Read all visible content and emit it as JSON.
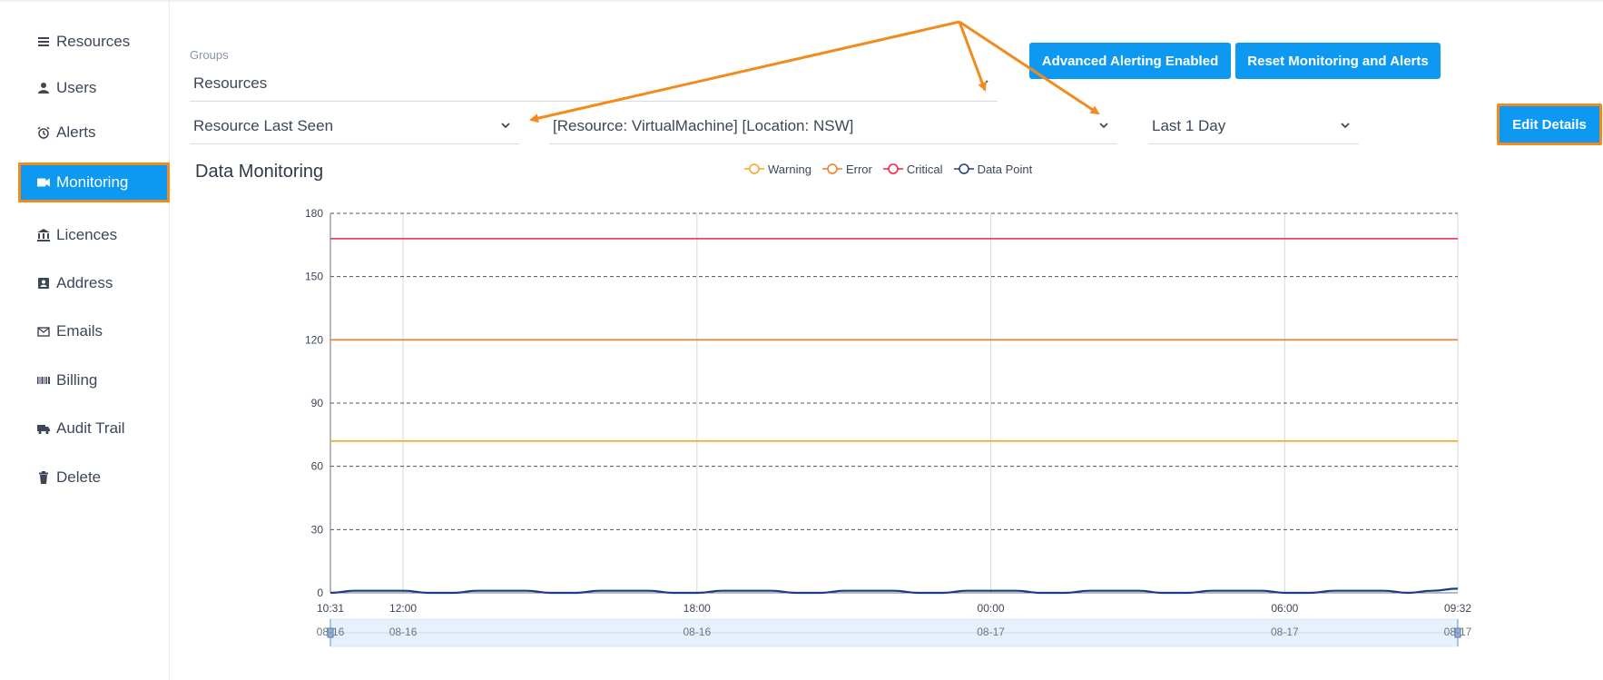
{
  "sidebar": {
    "items": [
      {
        "label": "Resources",
        "icon": "list-icon",
        "active": false
      },
      {
        "label": "Users",
        "icon": "user-icon",
        "active": false
      },
      {
        "label": "Alerts",
        "icon": "alarm-clock-icon",
        "active": false
      },
      {
        "label": "Monitoring",
        "icon": "video-camera-icon",
        "active": true
      },
      {
        "label": "Licences",
        "icon": "bank-icon",
        "active": false
      },
      {
        "label": "Address",
        "icon": "contact-card-icon",
        "active": false
      },
      {
        "label": "Emails",
        "icon": "envelope-icon",
        "active": false
      },
      {
        "label": "Billing",
        "icon": "barcode-icon",
        "active": false
      },
      {
        "label": "Audit Trail",
        "icon": "truck-icon",
        "active": false
      },
      {
        "label": "Delete",
        "icon": "trash-icon",
        "active": false
      }
    ]
  },
  "filters": {
    "groups_label": "Groups",
    "groups_value": "Resources",
    "metric_value": "Resource Last Seen",
    "resource_value": "[Resource: VirtualMachine] [Location: NSW]",
    "range_value": "Last 1 Day"
  },
  "buttons": {
    "advanced_alerting": "Advanced Alerting Enabled",
    "reset": "Reset Monitoring and Alerts",
    "edit_details": "Edit Details"
  },
  "section": {
    "title": "Data Monitoring"
  },
  "colors": {
    "accent": "#0d99f2",
    "highlight": "#f28a1c",
    "warning": "#f5a623",
    "error": "#ef7b2a",
    "critical": "#f0243f",
    "data_point": "#1f3b87"
  },
  "chart_data": {
    "type": "line",
    "title": "",
    "ylim": [
      0,
      180
    ],
    "yticks": [
      0,
      30,
      60,
      90,
      120,
      150,
      180
    ],
    "xlim": [
      "08-16 10:31",
      "08-17 09:32"
    ],
    "xticks": [
      {
        "time": "10:31",
        "date": "08-16"
      },
      {
        "time": "12:00",
        "date": "08-16"
      },
      {
        "time": "18:00",
        "date": "08-16"
      },
      {
        "time": "00:00",
        "date": "08-17"
      },
      {
        "time": "06:00",
        "date": "08-17"
      },
      {
        "time": "09:32",
        "date": "08-17"
      }
    ],
    "grid": true,
    "legend_position": "top",
    "series": [
      {
        "name": "Warning",
        "color": "#f5a623",
        "constant": 72
      },
      {
        "name": "Error",
        "color": "#ef7b2a",
        "constant": 120
      },
      {
        "name": "Critical",
        "color": "#f0243f",
        "constant": 168
      },
      {
        "name": "Data Point",
        "color": "#1f3b87",
        "x_minutes": [
          0,
          30,
          60,
          90,
          120,
          150,
          180,
          210,
          240,
          270,
          300,
          330,
          360,
          390,
          420,
          450,
          480,
          510,
          540,
          570,
          600,
          630,
          660,
          690,
          720,
          750,
          780,
          810,
          840,
          870,
          900,
          930,
          960,
          990,
          1020,
          1050,
          1080,
          1110,
          1140,
          1170,
          1200,
          1230,
          1260,
          1290,
          1320,
          1350,
          1381
        ],
        "values": [
          0,
          1,
          1,
          1,
          0,
          0,
          1,
          1,
          1,
          0,
          0,
          1,
          1,
          1,
          0,
          0,
          1,
          1,
          1,
          0,
          0,
          1,
          1,
          1,
          0,
          0,
          1,
          1,
          1,
          0,
          0,
          1,
          1,
          1,
          0,
          0,
          1,
          1,
          1,
          0,
          0,
          1,
          1,
          1,
          0,
          1,
          2
        ]
      }
    ]
  }
}
